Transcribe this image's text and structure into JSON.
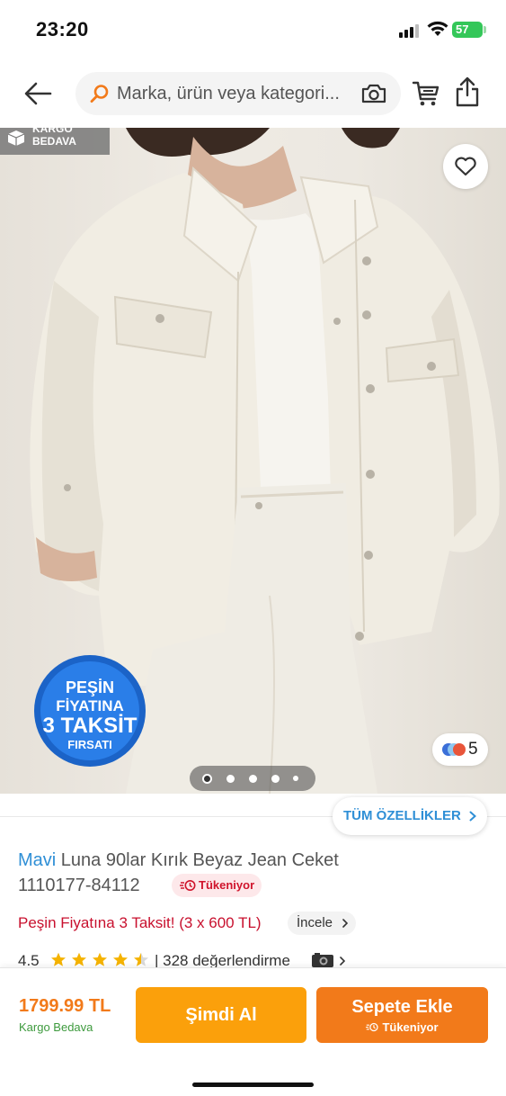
{
  "status_bar": {
    "time": "23:20",
    "battery": "57"
  },
  "topnav": {
    "search_placeholder": "Marka, ürün veya kategori...",
    "back_icon": "arrow-left-icon",
    "search_icon": "search-icon",
    "camera_icon": "camera-icon",
    "cart_icon": "cart-icon",
    "share_icon": "share-icon"
  },
  "gallery": {
    "kargo_badge_line1": "KARGO",
    "kargo_badge_line2": "BEDAVA",
    "promo_badge_text": [
      "PEŞİN",
      "FİYATINA",
      "3 TAKSİT",
      "FIRSATI"
    ],
    "color_count": "5",
    "pages": 5,
    "active_page": 1
  },
  "specs_button": "TÜM ÖZELLİKLER",
  "product": {
    "brand": "Mavi",
    "name": "Luna 90lar Kırık Beyaz Jean Ceket",
    "sku": "1110177-84112",
    "stock_status": "Tükeniyor",
    "installment_text": "Peşin Fiyatına 3 Taksit! (3 x 600 TL)",
    "incele_label": "İncele",
    "rating": "4.5",
    "rating_stars": 4.5,
    "review_count": "| 328 değerlendirme"
  },
  "bottom_bar": {
    "price": "1799.99 TL",
    "shipping": "Kargo Bedava",
    "buy_now": "Şimdi Al",
    "add_to_cart": "Sepete Ekle",
    "add_to_cart_sub": "Tükeniyor"
  },
  "colors": {
    "accent_orange": "#f27a1a",
    "buy_now_yellow": "#fba00b",
    "brand_blue": "#2f8fd6",
    "alert_red": "#d0142c",
    "shipping_green": "#3d9a3d"
  }
}
